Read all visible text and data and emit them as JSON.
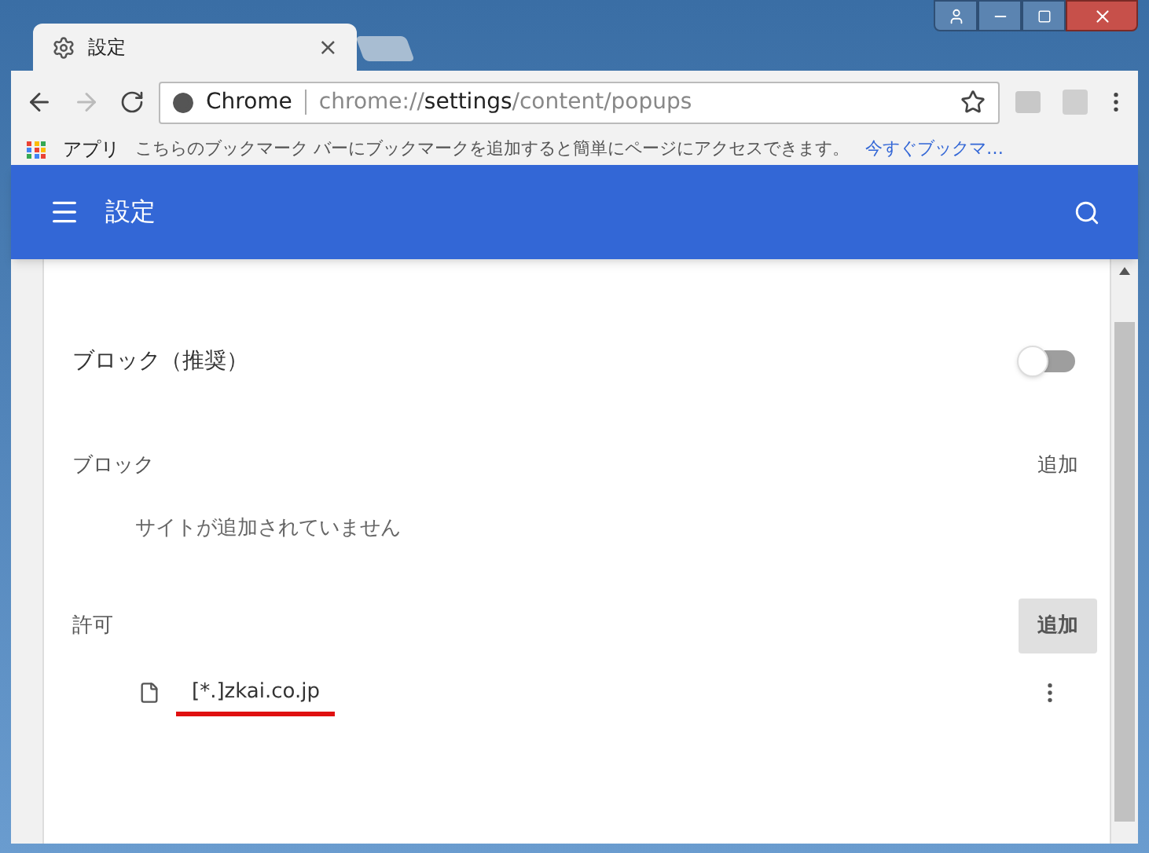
{
  "tab": {
    "title": "設定",
    "close": "×"
  },
  "toolbar": {
    "origin": "Chrome",
    "url_prefix": "chrome://",
    "url_host": "settings",
    "url_path": "/content/popups"
  },
  "bookmarks": {
    "apps": "アプリ",
    "message": "こちらのブックマーク バーにブックマークを追加すると簡単にページにアクセスできます。",
    "link": "今すぐブックマ…"
  },
  "header": {
    "title": "設定"
  },
  "toggle_row": {
    "label": "ブロック（推奨）",
    "on": false
  },
  "sections": [
    {
      "title": "ブロック",
      "add": "追加",
      "highlighted": false,
      "empty": "サイトが追加されていません"
    },
    {
      "title": "許可",
      "add": "追加",
      "highlighted": true,
      "sites": [
        {
          "host": "[*.]zkai.co.jp",
          "annotated": true
        }
      ]
    }
  ]
}
